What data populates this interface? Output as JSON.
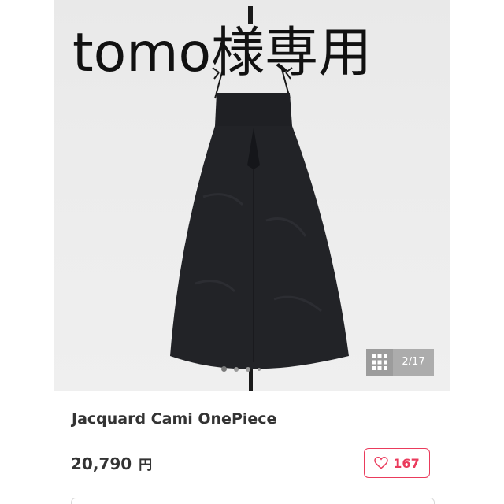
{
  "overlay": {
    "title": "tomo様専用"
  },
  "gallery": {
    "counter": "2/17",
    "grid_icon": "grid-icon",
    "dots_count": 4,
    "active_dot": 0
  },
  "product": {
    "title": "Jacquard Cami OnePiece",
    "price": "20,790",
    "currency": "円"
  },
  "like": {
    "icon": "heart-icon",
    "count": "167",
    "color": "#ea3b5c"
  }
}
